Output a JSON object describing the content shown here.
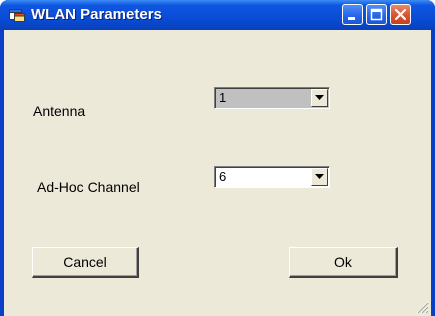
{
  "window": {
    "title": "WLAN Parameters",
    "app_icon": "application-window-icon",
    "controls": {
      "minimize": "minimize-icon",
      "maximize": "maximize-icon",
      "close": "close-icon"
    }
  },
  "form": {
    "antenna": {
      "label": "Antenna",
      "value": "1",
      "enabled": false
    },
    "adhoc_channel": {
      "label": "Ad-Hoc Channel",
      "value": "6",
      "enabled": true
    }
  },
  "buttons": {
    "cancel_label": "Cancel",
    "ok_label": "Ok"
  },
  "colors": {
    "title_bar": "#0b4fd9",
    "client_background": "#ece9d8",
    "disabled_field": "#c0c0c0",
    "close_button": "#d8532f"
  }
}
